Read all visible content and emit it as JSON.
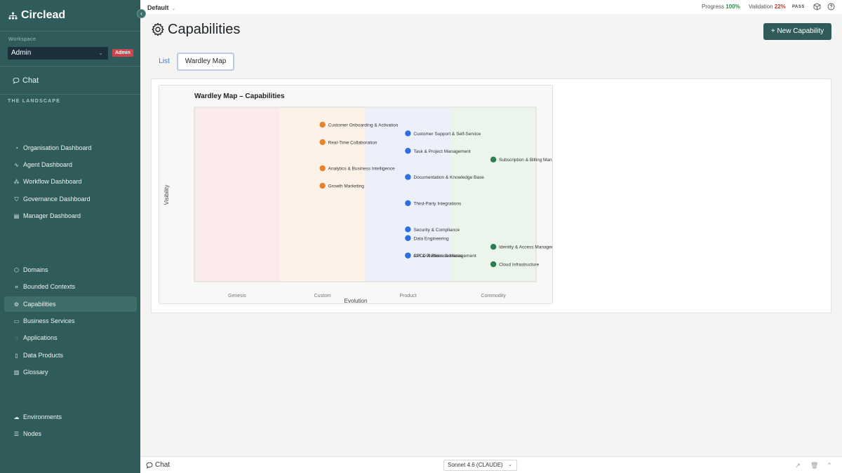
{
  "app": {
    "name": "Circlead"
  },
  "sidebar": {
    "workspace_label": "Workspace",
    "workspace_value": "Admin",
    "workspace_badge": "Admin",
    "chat_label": "Chat",
    "section_label": "THE LANDSCAPE",
    "items": [
      {
        "label": "Organisation Dashboard",
        "icon": "dashboard-icon"
      },
      {
        "label": "Agent Dashboard",
        "icon": "pulse-icon"
      },
      {
        "label": "Workflow Dashboard",
        "icon": "workflow-icon"
      },
      {
        "label": "Governance Dashboard",
        "icon": "shield-icon"
      },
      {
        "label": "Manager Dashboard",
        "icon": "chart-icon"
      },
      {
        "label": "Domains",
        "icon": "cube-icon"
      },
      {
        "label": "Bounded Contexts",
        "icon": "frame-icon"
      },
      {
        "label": "Capabilities",
        "icon": "gear-icon",
        "active": true
      },
      {
        "label": "Business Services",
        "icon": "briefcase-icon"
      },
      {
        "label": "Applications",
        "icon": "app-icon"
      },
      {
        "label": "Data Products",
        "icon": "file-icon"
      },
      {
        "label": "Glossary",
        "icon": "book-icon"
      },
      {
        "label": "Environments",
        "icon": "cloud-icon"
      },
      {
        "label": "Nodes",
        "icon": "server-icon"
      }
    ]
  },
  "topbar": {
    "environment": "Default",
    "progress_label": "Progress",
    "progress_value": "100%",
    "validation_label": "Validation",
    "validation_value": "22%",
    "validation_status": "PASS"
  },
  "header": {
    "title": "Capabilities",
    "new_button": "+ New Capability"
  },
  "tabs": [
    {
      "label": "List",
      "active": false
    },
    {
      "label": "Wardley Map",
      "active": true
    }
  ],
  "chart_data": {
    "type": "scatter",
    "title": "Wardley Map – Capabilities",
    "xlabel": "Evolution",
    "ylabel": "Visibility",
    "x_stages": [
      "Genesis",
      "Custom",
      "Product",
      "Commodity"
    ],
    "xlim": [
      0,
      1
    ],
    "ylim": [
      0,
      1
    ],
    "grid": false,
    "colors": {
      "custom": "#e8812a",
      "product": "#2f6fdc",
      "commodity": "#2e7d4f",
      "stage_genesis": "#fbe9e7",
      "stage_custom": "#fdf1e4",
      "stage_product": "#e9effb",
      "stage_commodity": "#e9f5ea"
    },
    "points": [
      {
        "label": "Customer Onboarding & Activation",
        "x": 0.375,
        "y": 0.9,
        "stage": "custom"
      },
      {
        "label": "Real-Time Collaboration",
        "x": 0.375,
        "y": 0.8,
        "stage": "custom"
      },
      {
        "label": "Analytics & Business Intelligence",
        "x": 0.375,
        "y": 0.65,
        "stage": "custom"
      },
      {
        "label": "Growth Marketing",
        "x": 0.375,
        "y": 0.55,
        "stage": "custom"
      },
      {
        "label": "Customer Support & Self-Service",
        "x": 0.625,
        "y": 0.85,
        "stage": "product"
      },
      {
        "label": "Task & Project Management",
        "x": 0.625,
        "y": 0.75,
        "stage": "product"
      },
      {
        "label": "Documentation & Knowledge Base",
        "x": 0.625,
        "y": 0.6,
        "stage": "product"
      },
      {
        "label": "Third-Party Integrations",
        "x": 0.625,
        "y": 0.45,
        "stage": "product"
      },
      {
        "label": "Security & Compliance",
        "x": 0.625,
        "y": 0.3,
        "stage": "product"
      },
      {
        "label": "Data Engineering",
        "x": 0.625,
        "y": 0.25,
        "stage": "product"
      },
      {
        "label": "CI/CD & Release Management",
        "x": 0.625,
        "y": 0.15,
        "stage": "product"
      },
      {
        "label": "API & Platform Services",
        "x": 0.625,
        "y": 0.15,
        "stage": "product"
      },
      {
        "label": "Subscription & Billing Management",
        "x": 0.875,
        "y": 0.7,
        "stage": "commodity"
      },
      {
        "label": "Identity & Access Management",
        "x": 0.875,
        "y": 0.2,
        "stage": "commodity"
      },
      {
        "label": "Cloud Infrastructure",
        "x": 0.875,
        "y": 0.1,
        "stage": "commodity"
      }
    ]
  },
  "bottombar": {
    "chat_label": "Chat",
    "model": "Sonnet 4.6 (CLAUDE)"
  }
}
